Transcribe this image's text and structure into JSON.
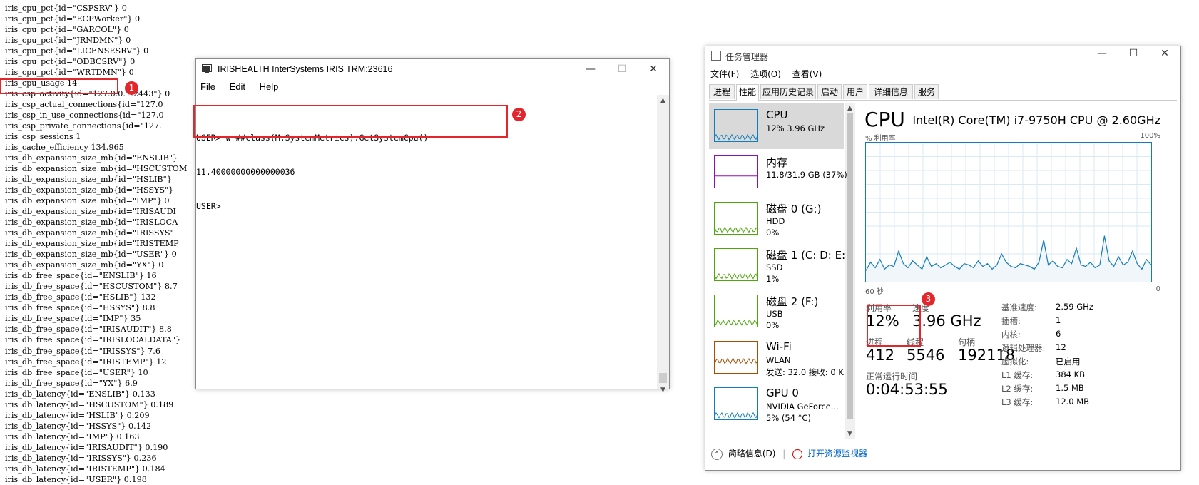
{
  "metrics": [
    "iris_cpu_pct{id=\"CSPSRV\"} 0",
    "iris_cpu_pct{id=\"ECPWorker\"} 0",
    "iris_cpu_pct{id=\"GARCOL\"} 0",
    "iris_cpu_pct{id=\"JRNDMN\"} 0",
    "iris_cpu_pct{id=\"LICENSESRV\"} 0",
    "iris_cpu_pct{id=\"ODBCSRV\"} 0",
    "iris_cpu_pct{id=\"WRTDMN\"} 0",
    "iris_cpu_usage 14",
    "iris_csp_activity{id=\"127.0.0.1:2443\"} 0",
    "iris_csp_actual_connections{id=\"127.0",
    "iris_csp_in_use_connections{id=\"127.0",
    "iris_csp_private_connections{id=\"127.",
    "iris_csp_sessions 1",
    "iris_cache_efficiency 134.965",
    "iris_db_expansion_size_mb{id=\"ENSLIB\"}",
    "iris_db_expansion_size_mb{id=\"HSCUSTOM",
    "iris_db_expansion_size_mb{id=\"HSLIB\"}",
    "iris_db_expansion_size_mb{id=\"HSSYS\"}",
    "iris_db_expansion_size_mb{id=\"IMP\"} 0",
    "iris_db_expansion_size_mb{id=\"IRISAUDI",
    "iris_db_expansion_size_mb{id=\"IRISLOCA",
    "iris_db_expansion_size_mb{id=\"IRISSYS\"",
    "iris_db_expansion_size_mb{id=\"IRISTEMP",
    "iris_db_expansion_size_mb{id=\"USER\"} 0",
    "iris_db_expansion_size_mb{id=\"YX\"} 0",
    "iris_db_free_space{id=\"ENSLIB\"} 16",
    "iris_db_free_space{id=\"HSCUSTOM\"} 8.7",
    "iris_db_free_space{id=\"HSLIB\"} 132",
    "iris_db_free_space{id=\"HSSYS\"} 8.8",
    "iris_db_free_space{id=\"IMP\"} 35",
    "iris_db_free_space{id=\"IRISAUDIT\"} 8.8",
    "iris_db_free_space{id=\"IRISLOCALDATA\"}",
    "iris_db_free_space{id=\"IRISSYS\"} 7.6",
    "iris_db_free_space{id=\"IRISTEMP\"} 12",
    "iris_db_free_space{id=\"USER\"} 10",
    "iris_db_free_space{id=\"YX\"} 6.9",
    "iris_db_latency{id=\"ENSLIB\"} 0.133",
    "iris_db_latency{id=\"HSCUSTOM\"} 0.189",
    "iris_db_latency{id=\"HSLIB\"} 0.209",
    "iris_db_latency{id=\"HSSYS\"} 0.142",
    "iris_db_latency{id=\"IMP\"} 0.163",
    "iris_db_latency{id=\"IRISAUDIT\"} 0.190",
    "iris_db_latency{id=\"IRISSYS\"} 0.236",
    "iris_db_latency{id=\"IRISTEMP\"} 0.184",
    "iris_db_latency{id=\"USER\"} 0.198"
  ],
  "markers": [
    "1",
    "2",
    "3"
  ],
  "terminal": {
    "title": "IRISHEALTH InterSystems IRIS TRM:23616",
    "menu": [
      "File",
      "Edit",
      "Help"
    ],
    "lines": [
      "USER> w ##class(M.SystemMetrics).GetSystemCpu()",
      "11.40000000000000036",
      "USER>"
    ]
  },
  "taskmgr": {
    "title": "任务管理器",
    "menu": [
      "文件(F)",
      "选项(O)",
      "查看(V)"
    ],
    "tabs": [
      "进程",
      "性能",
      "应用历史记录",
      "启动",
      "用户",
      "详细信息",
      "服务"
    ],
    "active_tab": "性能",
    "side": [
      {
        "name": "CPU",
        "sub1": "12% 3.96 GHz",
        "sub2": "",
        "color": "#117dbb"
      },
      {
        "name": "内存",
        "sub1": "11.8/31.9 GB (37%)",
        "sub2": "",
        "color": "#8b12ae"
      },
      {
        "name": "磁盘 0 (G:)",
        "sub1": "HDD",
        "sub2": "0%",
        "color": "#4da60c"
      },
      {
        "name": "磁盘 1 (C: D: E:",
        "sub1": "SSD",
        "sub2": "1%",
        "color": "#4da60c"
      },
      {
        "name": "磁盘 2 (F:)",
        "sub1": "USB",
        "sub2": "0%",
        "color": "#4da60c"
      },
      {
        "name": "Wi-Fi",
        "sub1": "WLAN",
        "sub2": "发送: 32.0 接收: 0 K",
        "color": "#a74f01"
      },
      {
        "name": "GPU 0",
        "sub1": "NVIDIA GeForce...",
        "sub2": "5% (54 °C)",
        "color": "#117dbb"
      }
    ],
    "cpu": {
      "title": "CPU",
      "model": "Intel(R) Core(TM) i7-9750H CPU @ 2.60GHz",
      "graph_label": "% 利用率",
      "graph_max": "100%",
      "time_left": "60 秒",
      "time_right": "0",
      "utilization_label": "利用率",
      "utilization": "12%",
      "speed_label": "速度",
      "speed": "3.96 GHz",
      "processes_label": "进程",
      "processes": "412",
      "threads_label": "线程",
      "threads": "5546",
      "handles_label": "句柄",
      "handles": "192118",
      "uptime_label": "正常运行时间",
      "uptime": "0:04:53:55",
      "specs": [
        {
          "k": "基准速度:",
          "v": "2.59 GHz"
        },
        {
          "k": "插槽:",
          "v": "1"
        },
        {
          "k": "内核:",
          "v": "6"
        },
        {
          "k": "逻辑处理器:",
          "v": "12"
        },
        {
          "k": "虚拟化:",
          "v": "已启用"
        },
        {
          "k": "L1 缓存:",
          "v": "384 KB"
        },
        {
          "k": "L2 缓存:",
          "v": "1.5 MB"
        },
        {
          "k": "L3 缓存:",
          "v": "12.0 MB"
        }
      ],
      "usage_history": [
        8,
        14,
        10,
        16,
        9,
        12,
        11,
        22,
        13,
        10,
        15,
        12,
        9,
        18,
        11,
        13,
        10,
        12,
        14,
        11,
        9,
        13,
        12,
        10,
        15,
        11,
        13,
        9,
        12,
        20,
        14,
        11,
        10,
        13,
        12,
        11,
        9,
        14,
        30,
        12,
        15,
        11,
        10,
        16,
        13,
        24,
        12,
        11,
        14,
        10,
        12,
        33,
        15,
        11,
        18,
        12,
        14,
        22,
        13,
        9,
        16,
        12
      ]
    },
    "footer": {
      "brief": "简略信息(D)",
      "monitor": "打开资源监视器"
    }
  }
}
